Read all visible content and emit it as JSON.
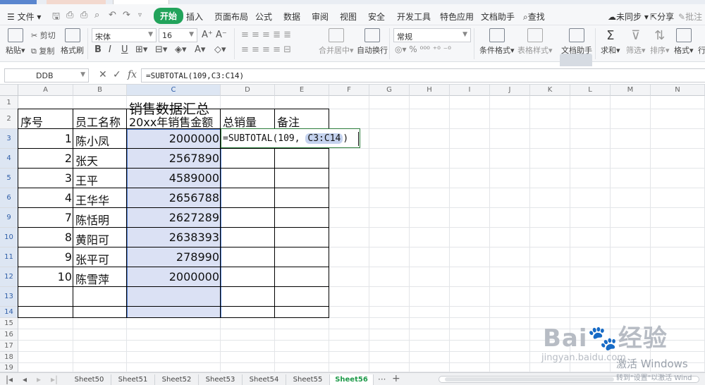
{
  "menu": {
    "file": "文件",
    "tabs": [
      "开始",
      "插入",
      "页面布局",
      "公式",
      "数据",
      "审阅",
      "视图",
      "安全",
      "开发工具",
      "特色应用",
      "文档助手"
    ],
    "search": "查找",
    "sync": "未同步",
    "share": "分享",
    "comment": "批注"
  },
  "ribbon": {
    "paste": "粘贴",
    "cut": "剪切",
    "copy": "复制",
    "format_painter": "格式刷",
    "font_name": "宋体",
    "font_size": "16",
    "merge_center": "合并居中",
    "wrap_text": "自动换行",
    "number_format": "常规",
    "conditional_format": "条件格式",
    "table_style": "表格样式",
    "doc_assistant": "文档助手",
    "sum": "求和",
    "filter": "筛选",
    "sort": "排序",
    "format": "格式",
    "row_col": "行"
  },
  "formula_bar": {
    "name_box": "DDB",
    "formula": "=SUBTOTAL(109,C3:C14)"
  },
  "grid": {
    "columns": [
      "A",
      "B",
      "C",
      "D",
      "E",
      "F",
      "G",
      "H",
      "I",
      "J",
      "K",
      "L",
      "M",
      "N"
    ],
    "row_numbers": [
      "1",
      "2",
      "3",
      "4",
      "5",
      "6",
      "9",
      "10",
      "11",
      "12",
      "13",
      "14",
      "15",
      "16",
      "17",
      "18",
      "19"
    ],
    "title": "销售数据汇总",
    "headers": [
      "序号",
      "员工名称",
      "20xx年销售金额",
      "总销量",
      "备注"
    ],
    "rows": [
      {
        "no": "1",
        "name": "陈小凤",
        "amount": "2000000"
      },
      {
        "no": "2",
        "name": "张天",
        "amount": "2567890"
      },
      {
        "no": "3",
        "name": "王平",
        "amount": "4589000"
      },
      {
        "no": "4",
        "name": "王华华",
        "amount": "2656788"
      },
      {
        "no": "7",
        "name": "陈恬明",
        "amount": "2627289"
      },
      {
        "no": "8",
        "name": "黄阳可",
        "amount": "2638393"
      },
      {
        "no": "9",
        "name": "张平可",
        "amount": "278990"
      },
      {
        "no": "10",
        "name": "陈雪萍",
        "amount": "2000000"
      }
    ],
    "editing_formula_prefix": "=SUBTOTAL(109, ",
    "editing_formula_ref": "C3:C14",
    "editing_formula_suffix": ")"
  },
  "sheets": {
    "tabs": [
      "Sheet50",
      "Sheet51",
      "Sheet52",
      "Sheet53",
      "Sheet54",
      "Sheet55",
      "Sheet56"
    ],
    "active": "Sheet56",
    "more": "···",
    "add": "+"
  },
  "watermark": {
    "brand": "Bai",
    "brand2": "经验",
    "url": "jingyan.baidu.com",
    "activate": "激活 Windows",
    "activate_hint": "转到\"设置\"以激活 Wind"
  }
}
